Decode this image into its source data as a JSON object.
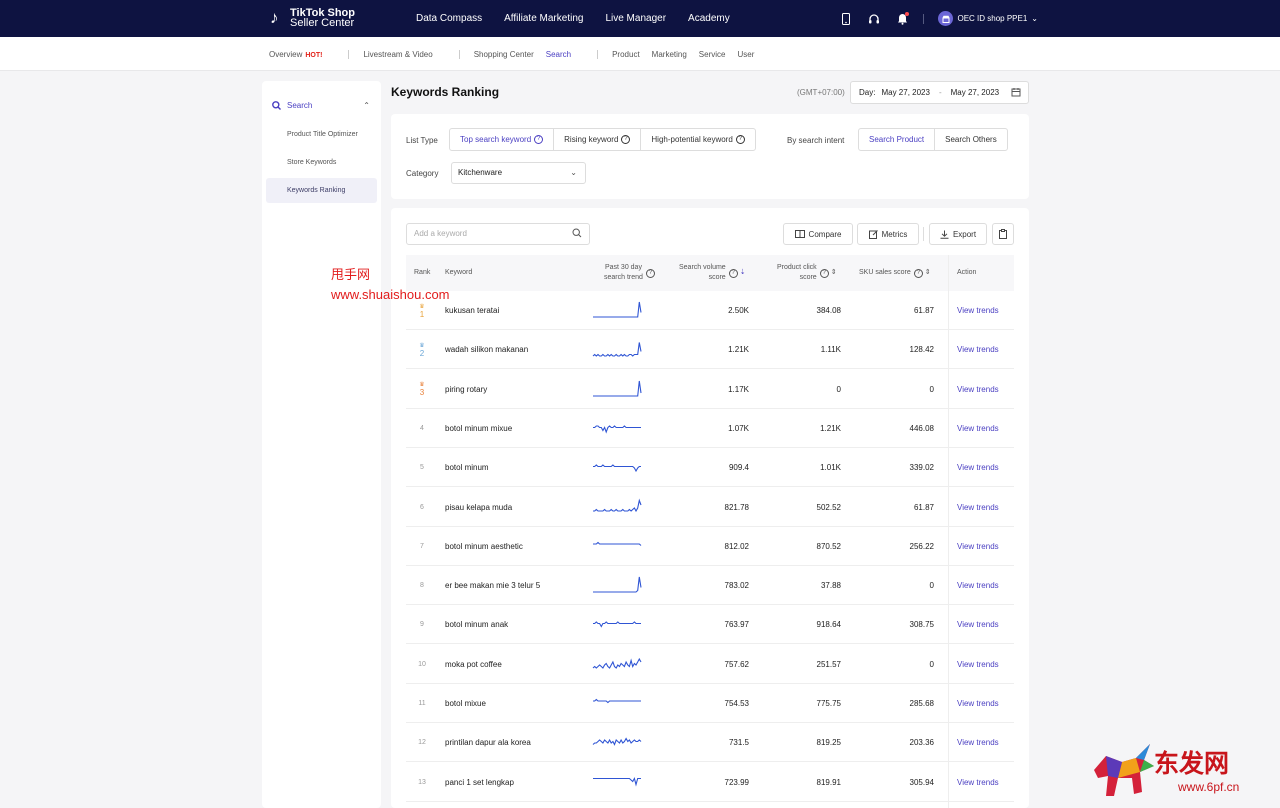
{
  "topbar": {
    "logo_line1": "TikTok Shop",
    "logo_line2": "Seller Center",
    "nav": [
      "Data Compass",
      "Affiliate Marketing",
      "Live Manager",
      "Academy"
    ],
    "shop_name": "OEC ID shop PPE1"
  },
  "subnav": {
    "items": [
      {
        "label": "Overview",
        "badge": "HOT!"
      },
      {
        "label": "Livestream & Video"
      },
      {
        "label": "Shopping Center"
      },
      {
        "label": "Search",
        "active": true
      },
      {
        "label": "Product"
      },
      {
        "label": "Marketing"
      },
      {
        "label": "Service"
      },
      {
        "label": "User"
      }
    ]
  },
  "sidebar": {
    "section": "Search",
    "items": [
      "Product Title Optimizer",
      "Store Keywords",
      "Keywords Ranking"
    ],
    "active_index": 2
  },
  "page": {
    "title": "Keywords Ranking",
    "timezone": "(GMT+07:00)",
    "day_label": "Day:",
    "date_from": "May 27, 2023",
    "date_to": "May 27, 2023"
  },
  "filters": {
    "list_type_label": "List Type",
    "list_types": [
      "Top search keyword",
      "Rising keyword",
      "High-potential keyword"
    ],
    "intent_label": "By search intent",
    "intents": [
      "Search Product",
      "Search Others"
    ],
    "category_label": "Category",
    "category_value": "Kitchenware"
  },
  "toolbar": {
    "search_placeholder": "Add a keyword",
    "compare": "Compare",
    "metrics": "Metrics",
    "export": "Export"
  },
  "table": {
    "headers": {
      "rank": "Rank",
      "keyword": "Keyword",
      "trend_1": "Past 30 day",
      "trend_2": "search trend",
      "volume_1": "Search volume",
      "volume_2": "score",
      "click_1": "Product click",
      "click_2": "score",
      "sku": "SKU sales score",
      "action": "Action"
    },
    "action_label": "View trends",
    "rows": [
      {
        "rank": "1",
        "keyword": "kukusan teratai",
        "volume": "2.50K",
        "click": "384.08",
        "sku": "61.87",
        "trend": [
          0,
          0,
          0,
          0,
          0,
          0,
          0,
          0,
          0,
          0,
          0,
          0,
          0,
          0,
          0,
          0,
          0,
          0,
          0,
          0,
          0,
          0,
          0,
          0,
          0,
          0,
          0,
          0,
          10,
          3
        ]
      },
      {
        "rank": "2",
        "keyword": "wadah silikon makanan",
        "volume": "1.21K",
        "click": "1.11K",
        "sku": "128.42",
        "trend": [
          0,
          1,
          0,
          1,
          0,
          0,
          1,
          0,
          0,
          1,
          0,
          1,
          0,
          0,
          1,
          0,
          0,
          1,
          0,
          1,
          0,
          0,
          1,
          1,
          0,
          1,
          1,
          1,
          9,
          3
        ]
      },
      {
        "rank": "3",
        "keyword": "piring rotary",
        "volume": "1.17K",
        "click": "0",
        "sku": "0",
        "trend": [
          0,
          0,
          0,
          0,
          0,
          0,
          0,
          0,
          0,
          0,
          0,
          0,
          0,
          0,
          0,
          0,
          0,
          0,
          0,
          0,
          0,
          0,
          0,
          0,
          0,
          0,
          0,
          0,
          10,
          2
        ]
      },
      {
        "rank": "4",
        "keyword": "botol minum mixue",
        "volume": "1.07K",
        "click": "1.21K",
        "sku": "446.08",
        "trend": [
          5,
          5,
          6,
          6,
          5,
          5,
          3,
          5,
          2,
          5,
          6,
          5,
          5,
          6,
          5,
          5,
          5,
          5,
          5,
          6,
          5,
          5,
          5,
          5,
          5,
          5,
          5,
          5,
          5,
          5
        ]
      },
      {
        "rank": "5",
        "keyword": "botol minum",
        "volume": "909.4",
        "click": "1.01K",
        "sku": "339.02",
        "trend": [
          5,
          5,
          6,
          5,
          5,
          5,
          6,
          5,
          5,
          5,
          5,
          5,
          6,
          5,
          5,
          5,
          5,
          5,
          5,
          5,
          5,
          5,
          5,
          5,
          5,
          4,
          2,
          4,
          5,
          5
        ]
      },
      {
        "rank": "6",
        "keyword": "pisau kelapa muda",
        "volume": "821.78",
        "click": "502.52",
        "sku": "61.87",
        "trend": [
          2,
          2,
          3,
          2,
          2,
          2,
          2,
          3,
          2,
          2,
          2,
          3,
          2,
          2,
          3,
          2,
          2,
          2,
          3,
          2,
          2,
          2,
          3,
          2,
          3,
          4,
          2,
          4,
          9,
          6
        ]
      },
      {
        "rank": "7",
        "keyword": "botol minum aesthetic",
        "volume": "812.02",
        "click": "870.52",
        "sku": "256.22",
        "trend": [
          6,
          6,
          6,
          7,
          6,
          6,
          6,
          6,
          6,
          6,
          6,
          6,
          6,
          6,
          6,
          6,
          6,
          6,
          6,
          6,
          6,
          6,
          6,
          6,
          6,
          6,
          6,
          6,
          6,
          5
        ]
      },
      {
        "rank": "8",
        "keyword": "er bee makan mie 3 telur 5",
        "volume": "783.02",
        "click": "37.88",
        "sku": "0",
        "trend": [
          0,
          0,
          0,
          0,
          0,
          0,
          0,
          0,
          0,
          0,
          0,
          0,
          0,
          0,
          0,
          0,
          0,
          0,
          0,
          0,
          0,
          0,
          0,
          0,
          0,
          0,
          0,
          1,
          10,
          3
        ]
      },
      {
        "rank": "9",
        "keyword": "botol minum anak",
        "volume": "763.97",
        "click": "918.64",
        "sku": "308.75",
        "trend": [
          5,
          5,
          6,
          5,
          5,
          3,
          5,
          5,
          6,
          5,
          5,
          5,
          5,
          5,
          5,
          6,
          5,
          5,
          5,
          5,
          5,
          5,
          5,
          5,
          5,
          6,
          5,
          5,
          5,
          5
        ]
      },
      {
        "rank": "10",
        "keyword": "moka pot coffee",
        "volume": "757.62",
        "click": "251.57",
        "sku": "0",
        "trend": [
          2,
          3,
          2,
          3,
          4,
          3,
          2,
          4,
          5,
          3,
          2,
          4,
          6,
          3,
          2,
          4,
          3,
          5,
          4,
          3,
          6,
          4,
          3,
          7,
          3,
          5,
          4,
          6,
          8,
          6
        ]
      },
      {
        "rank": "11",
        "keyword": "botol mixue",
        "volume": "754.53",
        "click": "775.75",
        "sku": "285.68",
        "trend": [
          6,
          6,
          7,
          6,
          6,
          6,
          6,
          6,
          6,
          5,
          6,
          6,
          6,
          6,
          6,
          6,
          6,
          6,
          6,
          6,
          6,
          6,
          6,
          6,
          6,
          6,
          6,
          6,
          6,
          6
        ]
      },
      {
        "rank": "12",
        "keyword": "printilan dapur ala korea",
        "volume": "731.5",
        "click": "819.25",
        "sku": "203.36",
        "trend": [
          3,
          4,
          4,
          5,
          6,
          5,
          4,
          6,
          5,
          4,
          6,
          4,
          5,
          3,
          6,
          5,
          4,
          6,
          4,
          5,
          7,
          5,
          6,
          4,
          5,
          6,
          5,
          5,
          6,
          5
        ]
      },
      {
        "rank": "13",
        "keyword": "panci 1 set lengkap",
        "volume": "723.99",
        "click": "819.91",
        "sku": "305.94",
        "trend": [
          7,
          7,
          7,
          7,
          7,
          7,
          7,
          7,
          7,
          7,
          7,
          7,
          7,
          7,
          7,
          7,
          7,
          7,
          7,
          7,
          7,
          7,
          7,
          6,
          5,
          7,
          3,
          7,
          7,
          7
        ]
      }
    ]
  },
  "colors": {
    "navy": "#0e1341",
    "accent": "#4a3fc2",
    "spark": "#2f55d4",
    "gold": "#e8a33b",
    "silver": "#6aa6d6",
    "bronze": "#e8813b"
  },
  "watermarks": {
    "left_cn": "甩手网",
    "left_url": "www.shuaishou.com",
    "right_brand": "东发网",
    "right_url": "www.6pf.cn"
  }
}
